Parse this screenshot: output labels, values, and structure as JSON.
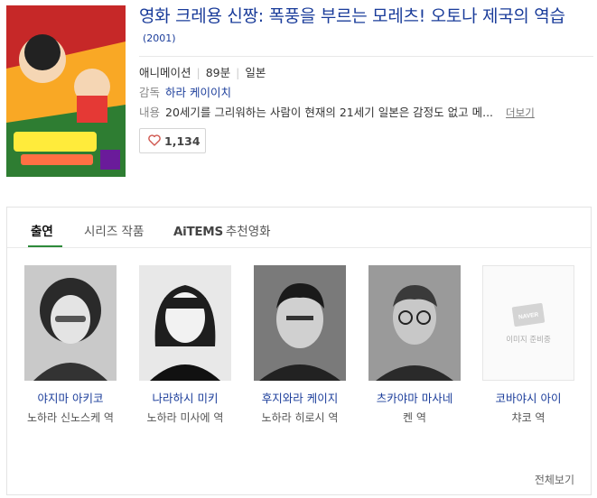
{
  "movie": {
    "title": "영화 크레용 신짱: 폭풍을 부르는 모레츠! 오토나 제국의 역습",
    "year": "(2001)",
    "genre": "애니메이션",
    "runtime": "89분",
    "country": "일본",
    "director_label": "감독",
    "director": "하라 케이이치",
    "summary_label": "내용",
    "summary": "20세기를 그리워하는 사람이 현재의 21세기 일본은 감정도 없고 메...",
    "more_link": "더보기",
    "likes": "1,134"
  },
  "tabs": {
    "cast": "출연",
    "series": "시리즈 작품",
    "aitems_brand": "AiTEMS",
    "aitems_label": "추천영화"
  },
  "cast": [
    {
      "name": "야지마 아키코",
      "role": "노하라 신노스케 역"
    },
    {
      "name": "나라하시 미키",
      "role": "노하라 미사에 역"
    },
    {
      "name": "후지와라 케이지",
      "role": "노하라 히로시 역"
    },
    {
      "name": "츠카야마 마사네",
      "role": "켄 역"
    },
    {
      "name": "코바야시 아이",
      "role": "챠코 역"
    }
  ],
  "placeholder_text": "이미지 준비중",
  "placeholder_badge": "NAVER",
  "view_all": "전체보기",
  "colors": {
    "link_blue": "#1a3c9a",
    "tab_accent": "#2d8a3a",
    "heart": "#d0574f"
  }
}
